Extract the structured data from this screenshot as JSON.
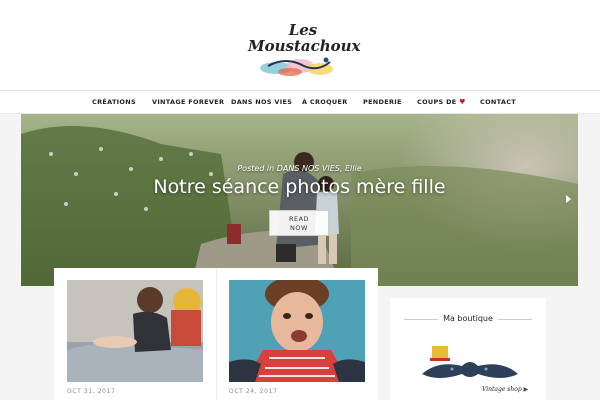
{
  "logo": {
    "text": "Les Moustachoux"
  },
  "nav": {
    "items": [
      {
        "label": "CRÉATIONS"
      },
      {
        "label": "VINTAGE FOREVER"
      },
      {
        "label": "DANS NOS VIES"
      },
      {
        "label": "À CROQUER"
      },
      {
        "label": "PENDERIE"
      },
      {
        "label": "COUPS DE"
      },
      {
        "label": "CONTACT"
      }
    ],
    "heart_icon": "heart-icon",
    "heart_color": "#b0262e"
  },
  "hero": {
    "posted_in": "Posted in",
    "category": "DANS NOS VIES",
    "separator": ",",
    "author": "Ellie",
    "title": "Notre séance photos mère fille",
    "button_line1": "READ",
    "button_line2": "NOW",
    "next_icon": "chevron-right-icon"
  },
  "posts": [
    {
      "date": "OCT 31, 2017"
    },
    {
      "date": "OCT 24, 2017"
    }
  ],
  "sidebar": {
    "widget_title": "Ma boutique",
    "shop_label": "Vintage shop",
    "shop_arrow": "▶"
  }
}
